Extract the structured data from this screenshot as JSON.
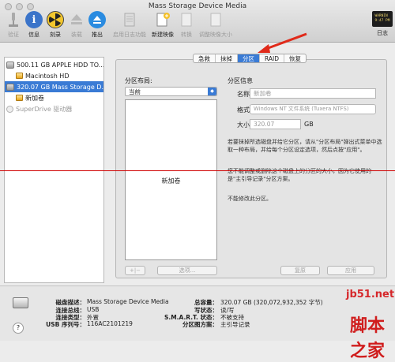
{
  "window": {
    "title": "Mass Storage Device Media"
  },
  "toolbar": {
    "items": [
      {
        "label": "验证",
        "icon": "microscope-icon"
      },
      {
        "label": "信息",
        "icon": "info-icon"
      },
      {
        "label": "刻录",
        "icon": "burn-icon"
      },
      {
        "label": "装载",
        "icon": "mount-icon"
      },
      {
        "label": "推出",
        "icon": "eject-icon"
      },
      {
        "label": "启用日志功能",
        "icon": "journal-icon"
      },
      {
        "label": "新建映像",
        "icon": "new-image-icon"
      },
      {
        "label": "转换",
        "icon": "convert-icon"
      },
      {
        "label": "调整映像大小",
        "icon": "resize-image-icon"
      }
    ],
    "log_label": "日志",
    "log_screen": "WARNIN\n9:47 PM"
  },
  "sidebar": {
    "items": [
      {
        "label": "500.11 GB APPLE HDD TO...",
        "type": "disk"
      },
      {
        "label": "Macintosh HD",
        "type": "volume"
      },
      {
        "label": "320.07 GB Mass Storage D...",
        "type": "disk"
      },
      {
        "label": "新加卷",
        "type": "volume"
      },
      {
        "label": "SuperDrive 驱动器",
        "type": "optical"
      }
    ]
  },
  "tabs": [
    "急救",
    "抹掉",
    "分区",
    "RAID",
    "恢复"
  ],
  "partition": {
    "layout_title": "分区布局:",
    "layout_select": "当前",
    "volume_name": "新加卷",
    "info_title": "分区信息",
    "name_label": "名称:",
    "name_placeholder": "新加卷",
    "format_label": "格式:",
    "format_value": "Windows NT 文件系统 (Tuxera NTFS)",
    "size_label": "大小:",
    "size_value": "320.07",
    "size_unit": "GB",
    "desc1": "若要抹掉所选磁盘并给它分区，请从\"分区布局\"弹出式菜单中选取一种布局，并给每个分区设定选项，然后点按\"应用\"。",
    "desc2": "您不能调整或删除这个磁盘上的分区的大小，因为它使用的是\"主引导记录\"分区方案。",
    "desc3": "不能修改此分区。",
    "add_remove": "+|−",
    "options_button": "选项...",
    "revert_button": "复原",
    "apply_button": "应用"
  },
  "footer": {
    "disk_desc_label": "磁盘描述：",
    "disk_desc_value": "Mass Storage Device Media",
    "conn_bus_label": "连接总线：",
    "conn_bus_value": "USB",
    "conn_type_label": "连接类型：",
    "conn_type_value": "外置",
    "usb_serial_label": "USB 序列号：",
    "usb_serial_value": "116AC2101219",
    "capacity_label": "总容量：",
    "capacity_value": "320.07 GB (320,072,932,352 字节)",
    "write_label": "写状态：",
    "write_value": "读/写",
    "smart_label": "S.M.A.R.T. 状态：",
    "smart_value": "不被支持",
    "scheme_label": "分区图方案：",
    "scheme_value": "主引导记录",
    "help": "?"
  },
  "watermark": {
    "line1": "jb51.net",
    "line2": "脚本之家"
  },
  "colors": {
    "accent": "#3a7bd5",
    "annotation_arrow": "#e02a1a"
  }
}
